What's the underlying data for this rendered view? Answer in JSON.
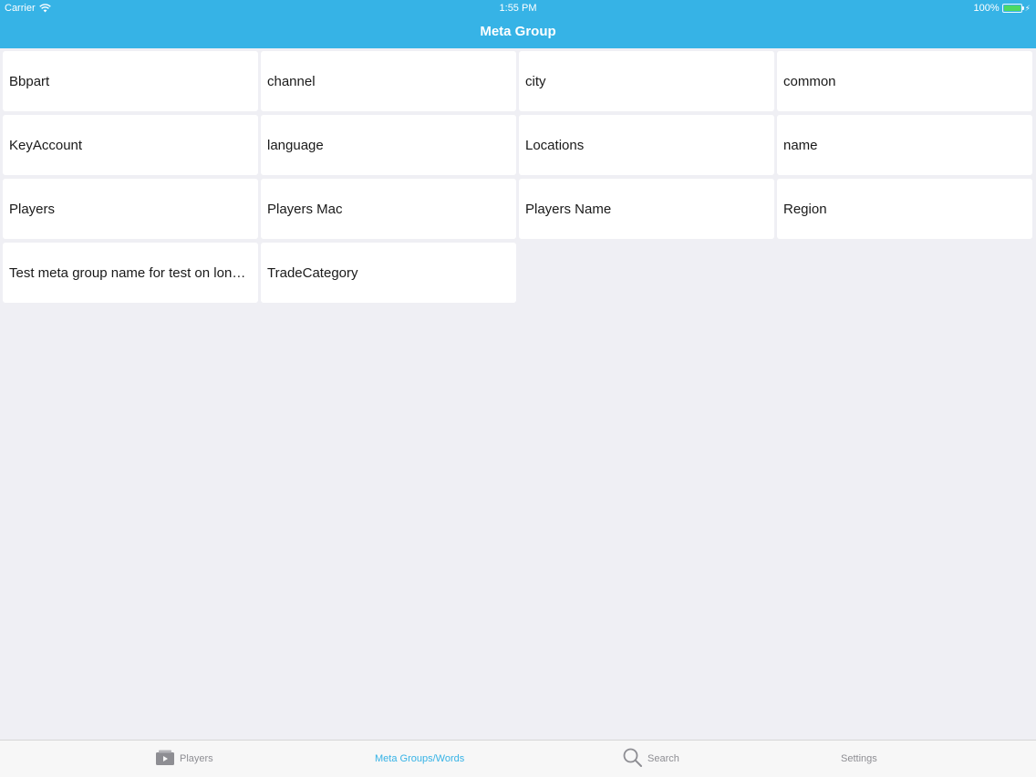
{
  "status_bar": {
    "carrier": "Carrier",
    "time": "1:55 PM",
    "battery": "100%",
    "wifi_icon": "wifi-icon",
    "battery_icon": "battery-icon"
  },
  "header": {
    "title": "Meta Group",
    "background": "#36b3e6"
  },
  "meta_groups": [
    "Bbpart",
    "channel",
    "city",
    "common",
    "KeyAccount",
    "language",
    "Locations",
    "name",
    "Players",
    "Players Mac",
    "Players Name",
    "Region",
    "Test meta group name for test on long n...",
    "TradeCategory"
  ],
  "tabbar": {
    "active_color": "#36b3e6",
    "inactive_color": "#8e8e93",
    "tabs": [
      {
        "label": "Players",
        "icon": "video-folder-icon"
      },
      {
        "label": "Meta Groups/Words",
        "icon": "",
        "active": true
      },
      {
        "label": "Search",
        "icon": "search-icon"
      },
      {
        "label": "Settings",
        "icon": ""
      }
    ]
  }
}
